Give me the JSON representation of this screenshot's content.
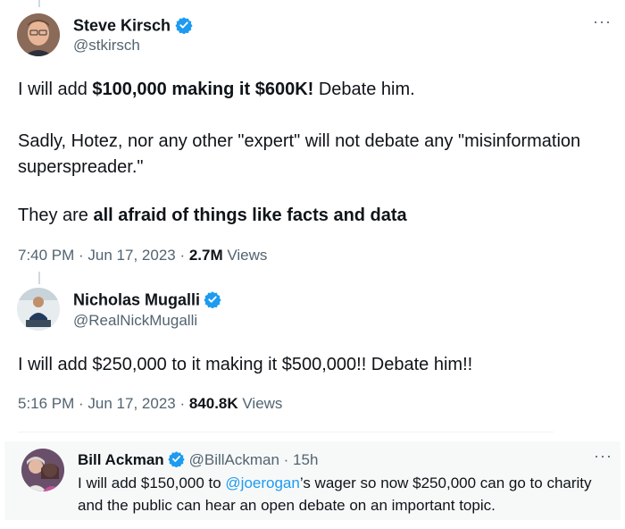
{
  "tweet1": {
    "name": "Steve Kirsch",
    "handle": "@stkirsch",
    "line1": {
      "pre": "I will add ",
      "bold": "$100,000 making it $600K!",
      "post": " Debate him."
    },
    "line2": "Sadly, Hotez, nor any other \"expert\" will not debate any \"misinformation superspreader.\"",
    "line3": {
      "pre": "They are ",
      "bold": "all afraid of things like facts and data"
    },
    "time": "7:40 PM · Jun 17, 2023 · ",
    "views_count": "2.7M",
    "views_label": " Views",
    "more_label": "···"
  },
  "tweet2": {
    "name": "Nicholas Mugalli",
    "handle": "@RealNickMugalli",
    "text": "I will add $250,000 to it making it $500,000!! Debate him!!",
    "time": "5:16 PM · Jun 17, 2023 · ",
    "views_count": "840.8K",
    "views_label": " Views"
  },
  "quote": {
    "name": "Bill Ackman",
    "handle": "@BillAckman · 15h",
    "text_pre": "I will add $150,000 to ",
    "mention": "@joerogan",
    "text_post": "’s wager so now $250,000 can go to charity and the public can hear an open debate on an important topic.",
    "more_label": "···"
  },
  "colors": {
    "accent": "#1d9bf0",
    "muted": "#536471",
    "text": "#0f1419",
    "quote_bg": "#f7f9f9"
  },
  "icons": [
    "verified-badge-icon",
    "more-options-icon"
  ]
}
